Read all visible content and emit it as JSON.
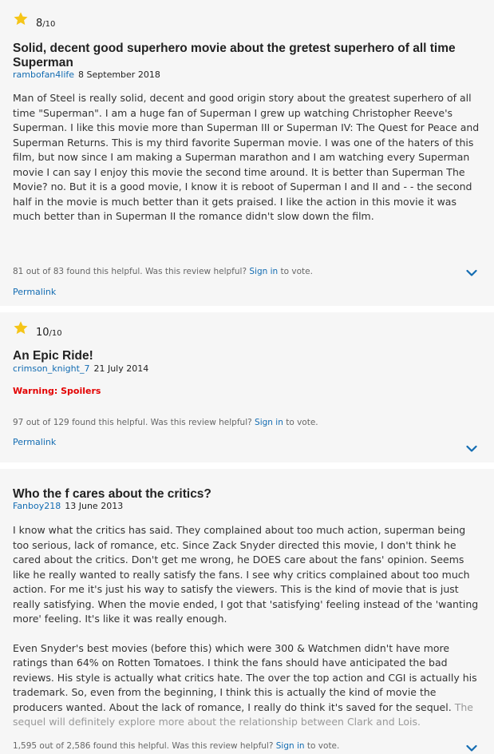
{
  "icons": {
    "star": "star-icon",
    "expand": "chevron-down-icon"
  },
  "colors": {
    "star": "#f5c518",
    "link": "#136cb2",
    "warning": "#e30000",
    "background": "#f6f6f6"
  },
  "reviews": [
    {
      "rating_value": "8",
      "rating_max": "/10",
      "title": "Solid, decent good superhero movie about the gretest superhero of all time Superman",
      "author": "rambofan4life",
      "date": "8 September 2018",
      "paragraphs": [
        "Man of Steel is really solid, decent and good origin story about the greatest superhero of all time \"Superman\". I am a huge fan of Superman I grew up watching Christopher Reeve's Superman. I like this movie more than Superman III or Superman IV: The Quest for Peace and Superman Returns. This is my third favorite Superman movie. I was one of the haters of this film, but now since I am making a Superman marathon and I am watching every Superman movie I can say I enjoy this movie the second time around. It is better than Superman The Movie? no. But it is a good movie, I know it is reboot of Superman I and II and - - the second half in the movie is much better than it gets praised. I like the action in this movie it was much better than in Superman II the romance didn't slow down the film."
      ],
      "helpful_text": "81 out of 83 found this helpful. Was this review helpful?",
      "sign_in": "Sign in",
      "to_vote": "to vote.",
      "permalink": "Permalink"
    },
    {
      "rating_value": "10",
      "rating_max": "/10",
      "title": "An Epic Ride!",
      "author": "crimson_knight_7",
      "date": "21 July 2014",
      "warning": "Warning: Spoilers",
      "helpful_text": "97 out of 129 found this helpful. Was this review helpful?",
      "sign_in": "Sign in",
      "to_vote": "to vote.",
      "permalink": "Permalink"
    },
    {
      "title": "Who the f cares about the critics?",
      "author": "Fanboy218",
      "date": "13 June 2013",
      "paragraphs": [
        "I know what the critics has said. They complained about too much action, superman being too serious, lack of romance, etc. Since Zack Snyder directed this movie, I don't think he cared about the critics. Don't get me wrong, he DOES care about the fans' opinion. Seems like he really wanted to really satisfy the fans. I see why critics complained about too much action. For me it's just his way to satisfy the viewers. This is the kind of movie that is just really satisfying. When the movie ended, I got that 'satisfying' feeling instead of the 'wanting more' feeling. It's like it was really enough.",
        "Even Snyder's best movies (before this) which were 300 & Watchmen didn't have more ratings than 64% on Rotten Tomatoes. I think the fans should have anticipated the bad reviews. His style is actually what critics hate. The over the top action and CGI is actually his trademark. So, even from the beginning, I think this is actually the kind of movie the producers wanted. About the lack of romance, I really do think it's saved for the sequel."
      ],
      "faded_text": "The sequel will definitely explore more about the relationship between Clark and Lois.",
      "helpful_text": "1,595 out of 2,586 found this helpful. Was this review helpful?",
      "sign_in": "Sign in",
      "to_vote": "to vote."
    }
  ]
}
